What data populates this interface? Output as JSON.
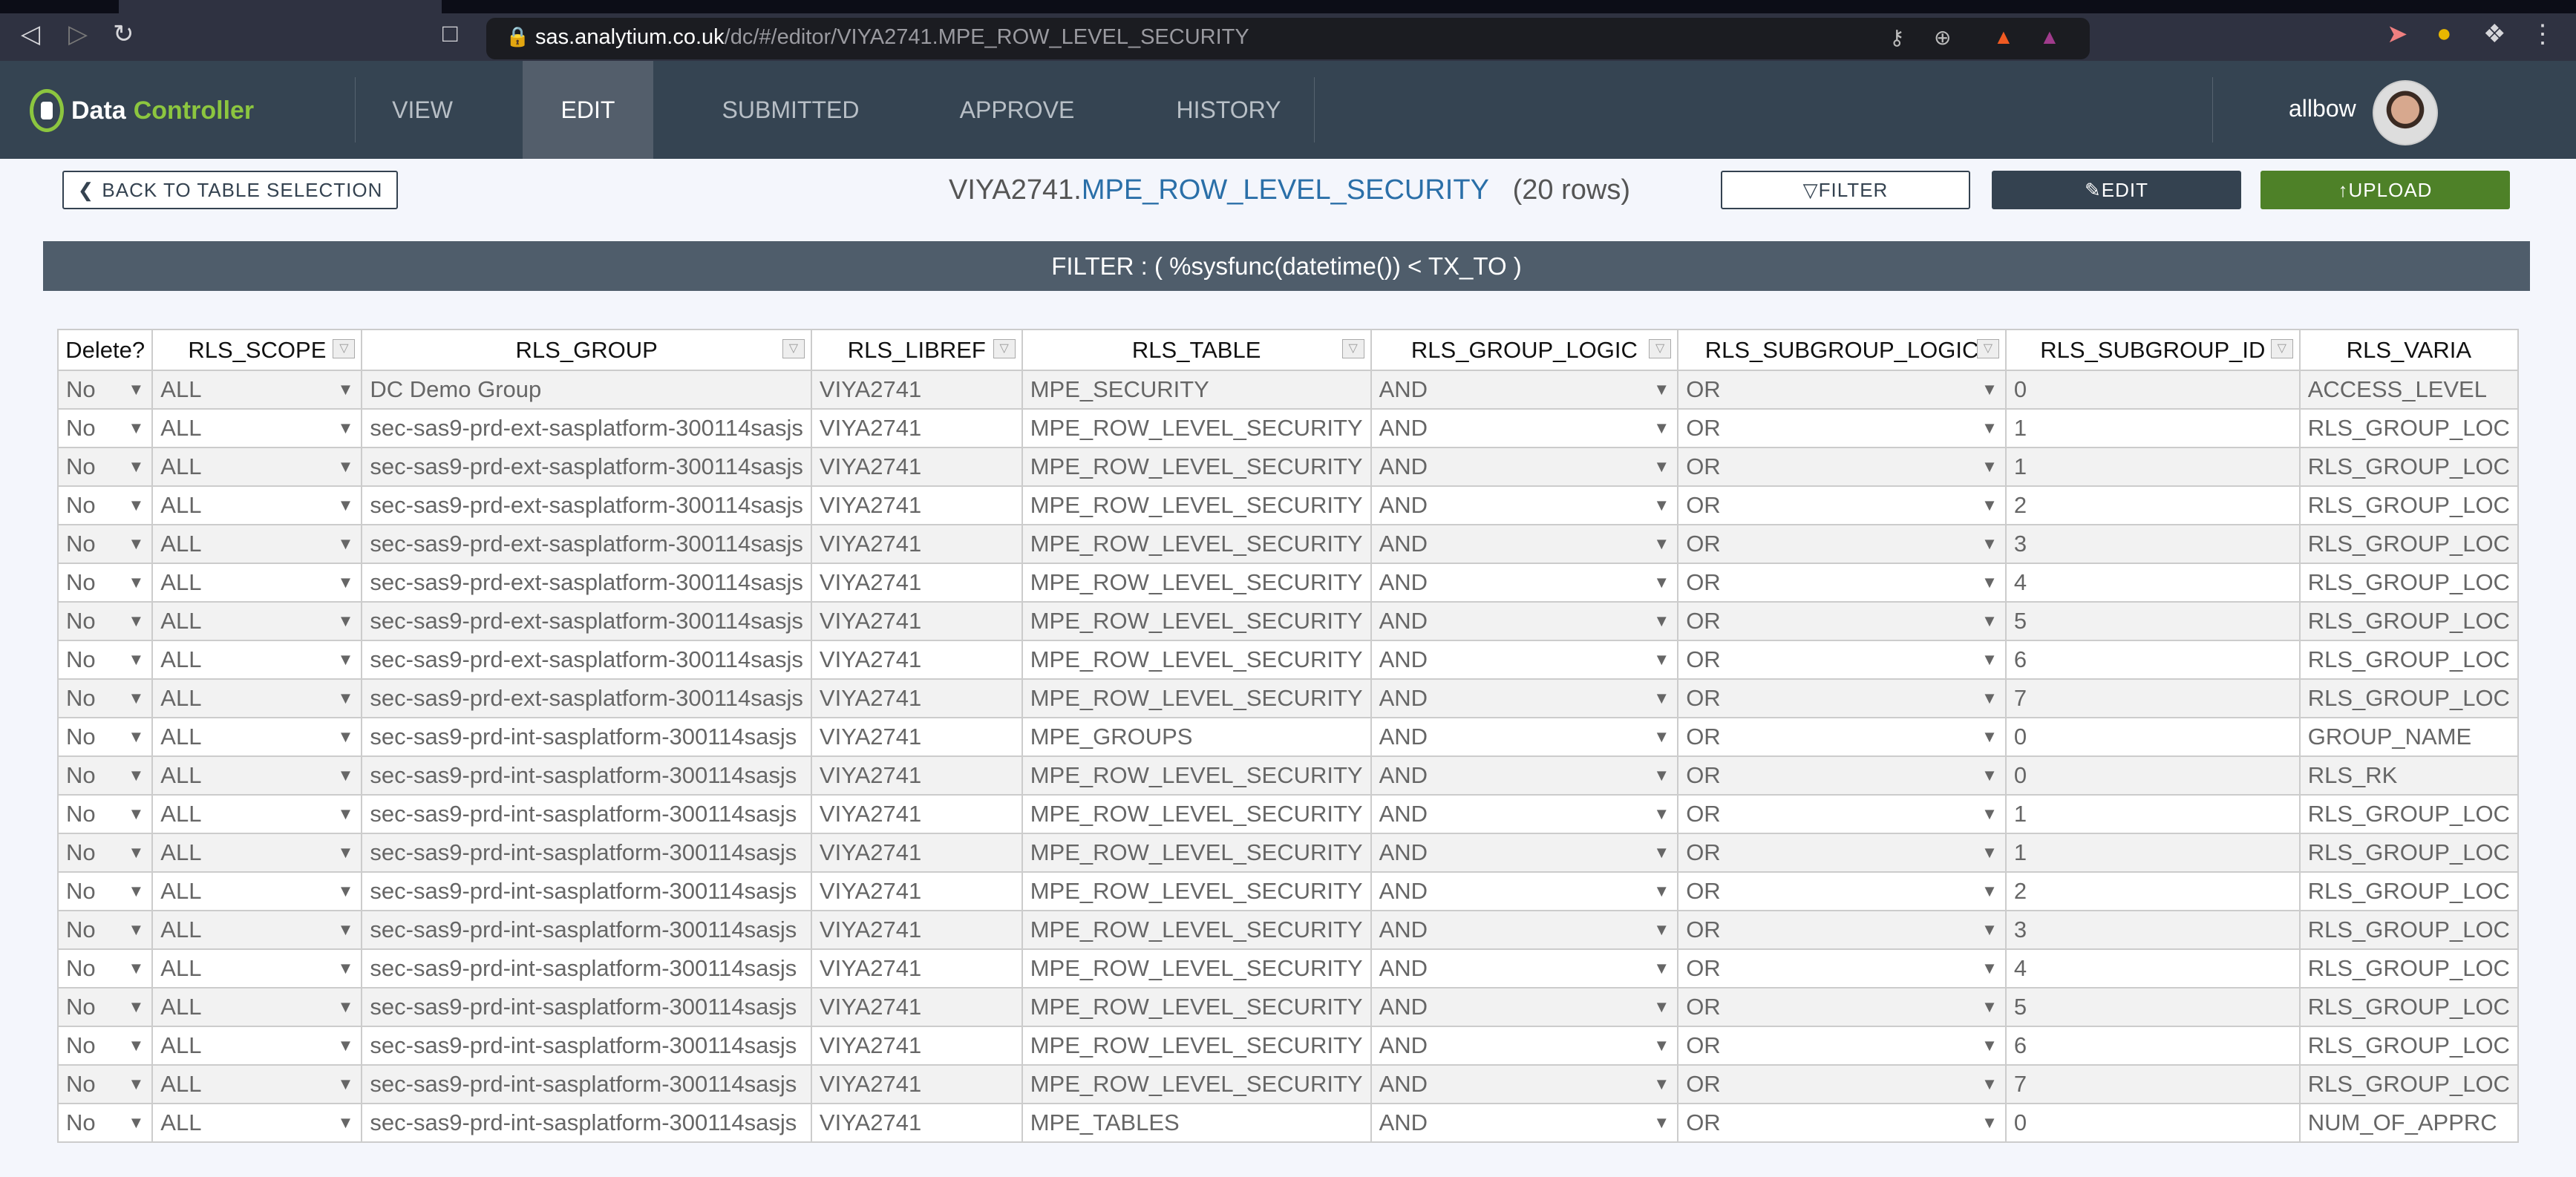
{
  "browser": {
    "url_host": "sas.analytium.co.uk",
    "url_path": "/dc/#/editor/VIYA2741.MPE_ROW_LEVEL_SECURITY"
  },
  "app": {
    "name_a": "Data",
    "name_b": "Controller",
    "user": "allbow"
  },
  "nav": [
    {
      "label": "VIEW"
    },
    {
      "label": "EDIT",
      "active": true
    },
    {
      "label": "SUBMITTED"
    },
    {
      "label": "APPROVE"
    },
    {
      "label": "HISTORY"
    }
  ],
  "toolbar": {
    "back": "BACK TO TABLE SELECTION",
    "filter": "FILTER",
    "edit": "EDIT",
    "upload": "UPLOAD"
  },
  "title": {
    "lib": "VIYA2741.",
    "table": "MPE_ROW_LEVEL_SECURITY",
    "rows": "(20 rows)"
  },
  "filter_text": "FILTER : ( %sysfunc(datetime()) < TX_TO )",
  "colors": {
    "nav": "#354452",
    "edit_button": "#344250",
    "upload_button": "#4e8128",
    "title_accent": "#2a6fa8"
  },
  "columns": [
    "Delete?",
    "RLS_SCOPE",
    "RLS_GROUP",
    "RLS_LIBREF",
    "RLS_TABLE",
    "RLS_GROUP_LOGIC",
    "RLS_SUBGROUP_LOGIC",
    "RLS_SUBGROUP_ID",
    "RLS_VARIA"
  ],
  "rows": [
    [
      "No",
      "ALL",
      "DC Demo Group",
      "VIYA2741",
      "MPE_SECURITY",
      "AND",
      "OR",
      "0",
      "ACCESS_LEVEL"
    ],
    [
      "No",
      "ALL",
      "sec-sas9-prd-ext-sasplatform-300114sasjs",
      "VIYA2741",
      "MPE_ROW_LEVEL_SECURITY",
      "AND",
      "OR",
      "1",
      "RLS_GROUP_LOC"
    ],
    [
      "No",
      "ALL",
      "sec-sas9-prd-ext-sasplatform-300114sasjs",
      "VIYA2741",
      "MPE_ROW_LEVEL_SECURITY",
      "AND",
      "OR",
      "1",
      "RLS_GROUP_LOC"
    ],
    [
      "No",
      "ALL",
      "sec-sas9-prd-ext-sasplatform-300114sasjs",
      "VIYA2741",
      "MPE_ROW_LEVEL_SECURITY",
      "AND",
      "OR",
      "2",
      "RLS_GROUP_LOC"
    ],
    [
      "No",
      "ALL",
      "sec-sas9-prd-ext-sasplatform-300114sasjs",
      "VIYA2741",
      "MPE_ROW_LEVEL_SECURITY",
      "AND",
      "OR",
      "3",
      "RLS_GROUP_LOC"
    ],
    [
      "No",
      "ALL",
      "sec-sas9-prd-ext-sasplatform-300114sasjs",
      "VIYA2741",
      "MPE_ROW_LEVEL_SECURITY",
      "AND",
      "OR",
      "4",
      "RLS_GROUP_LOC"
    ],
    [
      "No",
      "ALL",
      "sec-sas9-prd-ext-sasplatform-300114sasjs",
      "VIYA2741",
      "MPE_ROW_LEVEL_SECURITY",
      "AND",
      "OR",
      "5",
      "RLS_GROUP_LOC"
    ],
    [
      "No",
      "ALL",
      "sec-sas9-prd-ext-sasplatform-300114sasjs",
      "VIYA2741",
      "MPE_ROW_LEVEL_SECURITY",
      "AND",
      "OR",
      "6",
      "RLS_GROUP_LOC"
    ],
    [
      "No",
      "ALL",
      "sec-sas9-prd-ext-sasplatform-300114sasjs",
      "VIYA2741",
      "MPE_ROW_LEVEL_SECURITY",
      "AND",
      "OR",
      "7",
      "RLS_GROUP_LOC"
    ],
    [
      "No",
      "ALL",
      "sec-sas9-prd-int-sasplatform-300114sasjs",
      "VIYA2741",
      "MPE_GROUPS",
      "AND",
      "OR",
      "0",
      "GROUP_NAME"
    ],
    [
      "No",
      "ALL",
      "sec-sas9-prd-int-sasplatform-300114sasjs",
      "VIYA2741",
      "MPE_ROW_LEVEL_SECURITY",
      "AND",
      "OR",
      "0",
      "RLS_RK"
    ],
    [
      "No",
      "ALL",
      "sec-sas9-prd-int-sasplatform-300114sasjs",
      "VIYA2741",
      "MPE_ROW_LEVEL_SECURITY",
      "AND",
      "OR",
      "1",
      "RLS_GROUP_LOC"
    ],
    [
      "No",
      "ALL",
      "sec-sas9-prd-int-sasplatform-300114sasjs",
      "VIYA2741",
      "MPE_ROW_LEVEL_SECURITY",
      "AND",
      "OR",
      "1",
      "RLS_GROUP_LOC"
    ],
    [
      "No",
      "ALL",
      "sec-sas9-prd-int-sasplatform-300114sasjs",
      "VIYA2741",
      "MPE_ROW_LEVEL_SECURITY",
      "AND",
      "OR",
      "2",
      "RLS_GROUP_LOC"
    ],
    [
      "No",
      "ALL",
      "sec-sas9-prd-int-sasplatform-300114sasjs",
      "VIYA2741",
      "MPE_ROW_LEVEL_SECURITY",
      "AND",
      "OR",
      "3",
      "RLS_GROUP_LOC"
    ],
    [
      "No",
      "ALL",
      "sec-sas9-prd-int-sasplatform-300114sasjs",
      "VIYA2741",
      "MPE_ROW_LEVEL_SECURITY",
      "AND",
      "OR",
      "4",
      "RLS_GROUP_LOC"
    ],
    [
      "No",
      "ALL",
      "sec-sas9-prd-int-sasplatform-300114sasjs",
      "VIYA2741",
      "MPE_ROW_LEVEL_SECURITY",
      "AND",
      "OR",
      "5",
      "RLS_GROUP_LOC"
    ],
    [
      "No",
      "ALL",
      "sec-sas9-prd-int-sasplatform-300114sasjs",
      "VIYA2741",
      "MPE_ROW_LEVEL_SECURITY",
      "AND",
      "OR",
      "6",
      "RLS_GROUP_LOC"
    ],
    [
      "No",
      "ALL",
      "sec-sas9-prd-int-sasplatform-300114sasjs",
      "VIYA2741",
      "MPE_ROW_LEVEL_SECURITY",
      "AND",
      "OR",
      "7",
      "RLS_GROUP_LOC"
    ],
    [
      "No",
      "ALL",
      "sec-sas9-prd-int-sasplatform-300114sasjs",
      "VIYA2741",
      "MPE_TABLES",
      "AND",
      "OR",
      "0",
      "NUM_OF_APPRC"
    ]
  ]
}
